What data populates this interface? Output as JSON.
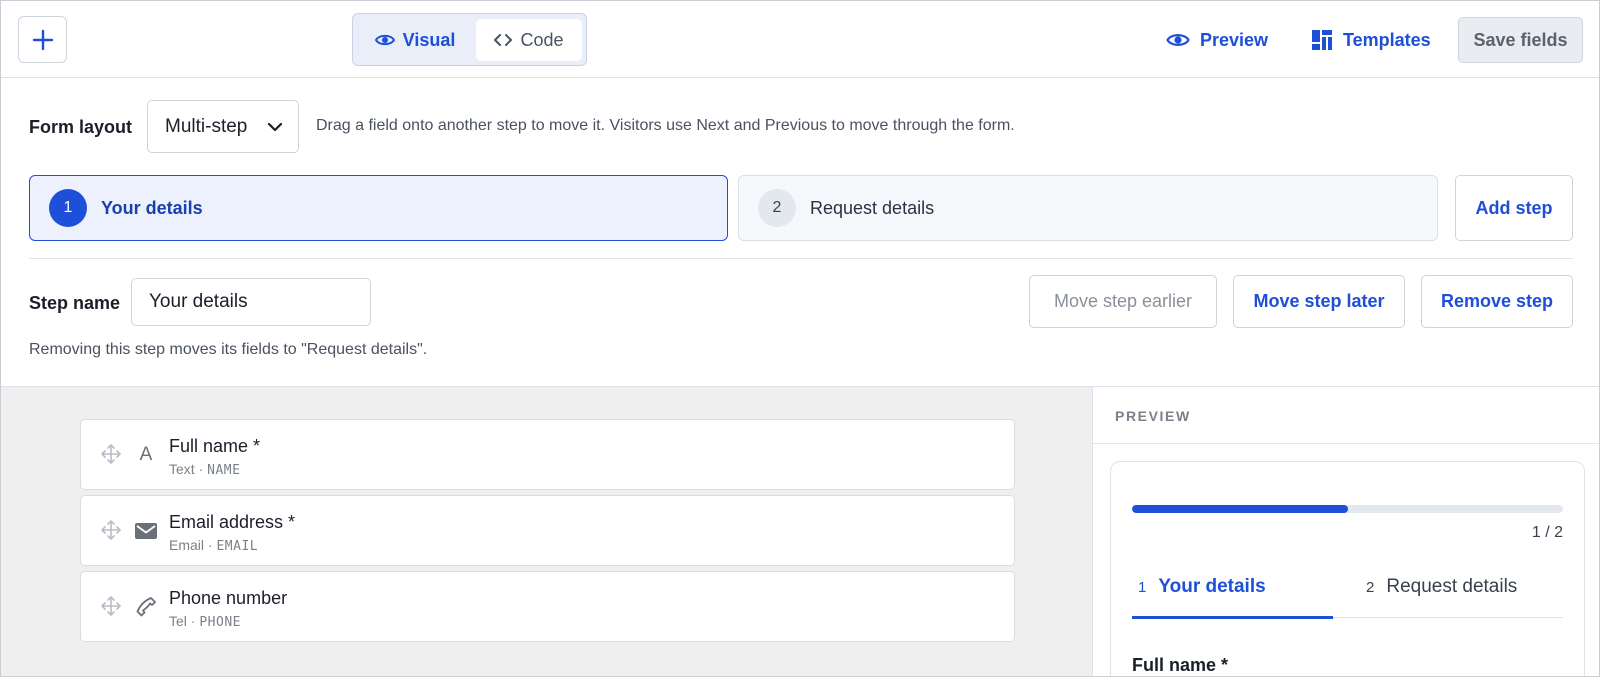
{
  "toolbar": {
    "add_icon": "plus-icon",
    "mode_visual": "Visual",
    "mode_code": "Code",
    "active_mode": "Visual",
    "preview_label": "Preview",
    "templates_label": "Templates",
    "save_label": "Save fields"
  },
  "layout": {
    "label": "Form layout",
    "value": "Multi-step",
    "hint": "Drag a field onto another step to move it. Visitors use Next and Previous to move through the form."
  },
  "steps": [
    {
      "num": "1",
      "title": "Your details",
      "active": true
    },
    {
      "num": "2",
      "title": "Request details",
      "active": false
    }
  ],
  "add_step_label": "Add step",
  "step_editor": {
    "label": "Step name",
    "value": "Your details",
    "move_earlier": "Move step earlier",
    "move_later": "Move step later",
    "remove": "Remove step",
    "note": "Removing this step moves its fields to \"Request details\"."
  },
  "fields": [
    {
      "title": "Full name *",
      "type": "Text",
      "key": "NAME",
      "icon": "text-icon",
      "glyph": "A"
    },
    {
      "title": "Email address *",
      "type": "Email",
      "key": "EMAIL",
      "icon": "envelope-icon",
      "glyph": ""
    },
    {
      "title": "Phone number",
      "type": "Tel",
      "key": "PHONE",
      "icon": "phone-icon",
      "glyph": ""
    }
  ],
  "meta_separator": "·",
  "preview": {
    "label": "PREVIEW",
    "progress": 0.5,
    "count": "1 / 2",
    "tabs": [
      {
        "num": "1",
        "title": "Your details"
      },
      {
        "num": "2",
        "title": "Request details"
      }
    ],
    "first_field": "Full name *"
  },
  "colors": {
    "accent": "#1e4fd8",
    "canvas_bg": "#efefef"
  }
}
